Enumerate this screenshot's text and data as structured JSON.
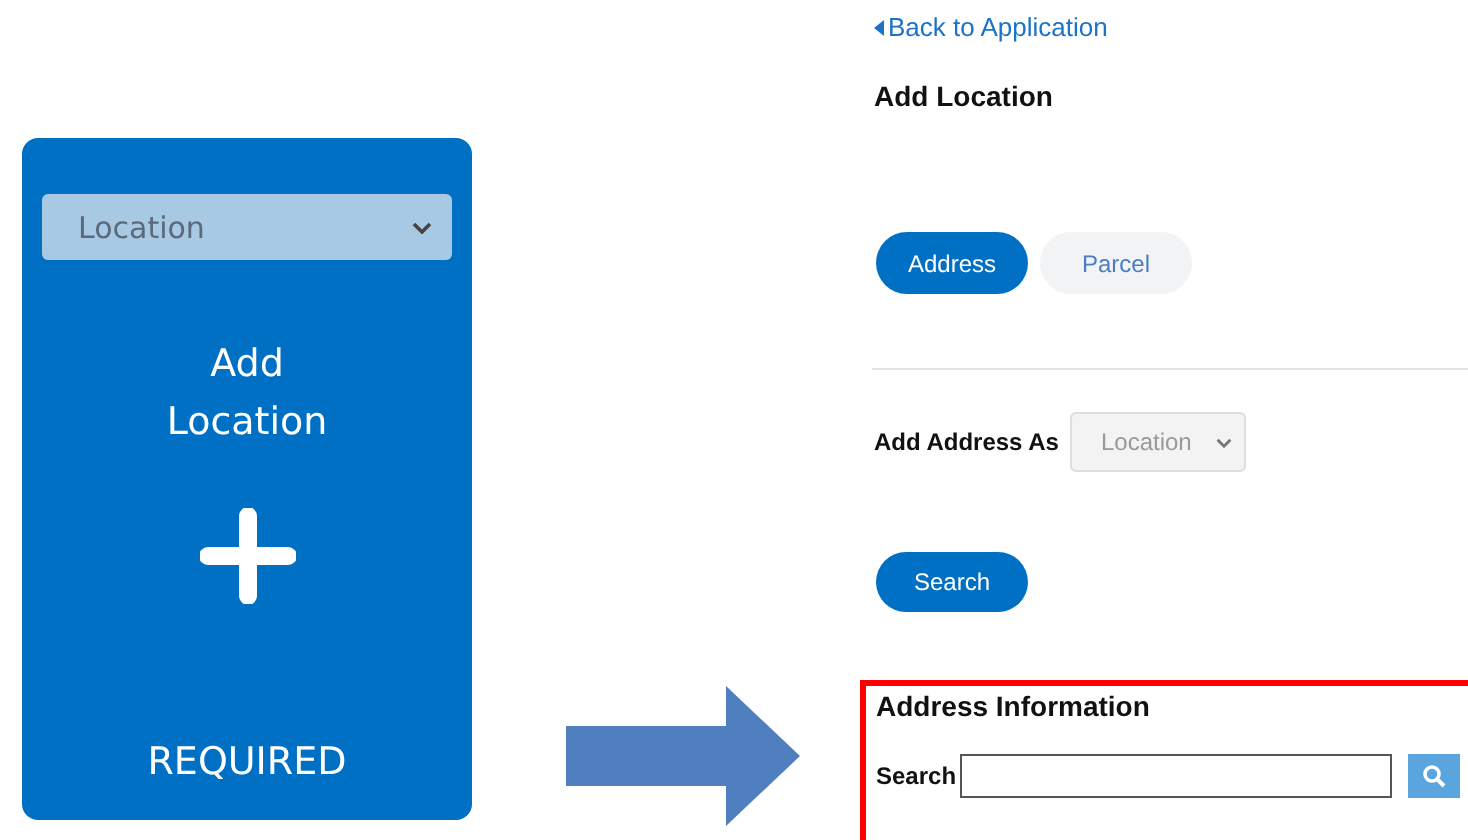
{
  "card": {
    "dropdown": "Location",
    "title_lines": [
      "Add",
      "Location"
    ],
    "status": "REQUIRED"
  },
  "panel": {
    "back_link": "Back to Application",
    "heading": "Add Location",
    "tabs": [
      {
        "label": "Address",
        "selected": true
      },
      {
        "label": "Parcel",
        "selected": false
      }
    ],
    "add_as": {
      "label": "Add Address As",
      "value": "Location"
    },
    "search_button": "Search",
    "address_information": {
      "heading": "Address Information",
      "search_label": "Search",
      "highlighted": true
    }
  }
}
